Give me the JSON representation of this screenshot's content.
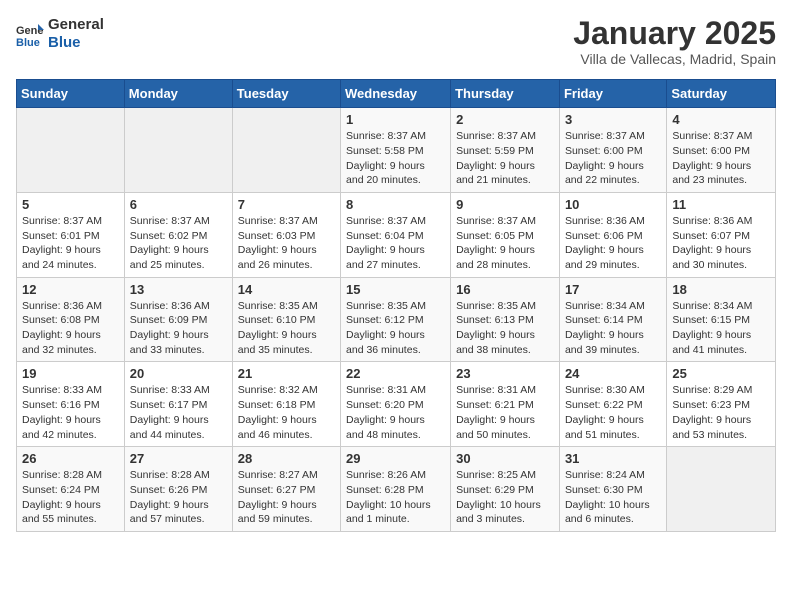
{
  "logo": {
    "line1": "General",
    "line2": "Blue"
  },
  "title": "January 2025",
  "location": "Villa de Vallecas, Madrid, Spain",
  "weekdays": [
    "Sunday",
    "Monday",
    "Tuesday",
    "Wednesday",
    "Thursday",
    "Friday",
    "Saturday"
  ],
  "weeks": [
    [
      {
        "day": "",
        "info": ""
      },
      {
        "day": "",
        "info": ""
      },
      {
        "day": "",
        "info": ""
      },
      {
        "day": "1",
        "info": "Sunrise: 8:37 AM\nSunset: 5:58 PM\nDaylight: 9 hours\nand 20 minutes."
      },
      {
        "day": "2",
        "info": "Sunrise: 8:37 AM\nSunset: 5:59 PM\nDaylight: 9 hours\nand 21 minutes."
      },
      {
        "day": "3",
        "info": "Sunrise: 8:37 AM\nSunset: 6:00 PM\nDaylight: 9 hours\nand 22 minutes."
      },
      {
        "day": "4",
        "info": "Sunrise: 8:37 AM\nSunset: 6:00 PM\nDaylight: 9 hours\nand 23 minutes."
      }
    ],
    [
      {
        "day": "5",
        "info": "Sunrise: 8:37 AM\nSunset: 6:01 PM\nDaylight: 9 hours\nand 24 minutes."
      },
      {
        "day": "6",
        "info": "Sunrise: 8:37 AM\nSunset: 6:02 PM\nDaylight: 9 hours\nand 25 minutes."
      },
      {
        "day": "7",
        "info": "Sunrise: 8:37 AM\nSunset: 6:03 PM\nDaylight: 9 hours\nand 26 minutes."
      },
      {
        "day": "8",
        "info": "Sunrise: 8:37 AM\nSunset: 6:04 PM\nDaylight: 9 hours\nand 27 minutes."
      },
      {
        "day": "9",
        "info": "Sunrise: 8:37 AM\nSunset: 6:05 PM\nDaylight: 9 hours\nand 28 minutes."
      },
      {
        "day": "10",
        "info": "Sunrise: 8:36 AM\nSunset: 6:06 PM\nDaylight: 9 hours\nand 29 minutes."
      },
      {
        "day": "11",
        "info": "Sunrise: 8:36 AM\nSunset: 6:07 PM\nDaylight: 9 hours\nand 30 minutes."
      }
    ],
    [
      {
        "day": "12",
        "info": "Sunrise: 8:36 AM\nSunset: 6:08 PM\nDaylight: 9 hours\nand 32 minutes."
      },
      {
        "day": "13",
        "info": "Sunrise: 8:36 AM\nSunset: 6:09 PM\nDaylight: 9 hours\nand 33 minutes."
      },
      {
        "day": "14",
        "info": "Sunrise: 8:35 AM\nSunset: 6:10 PM\nDaylight: 9 hours\nand 35 minutes."
      },
      {
        "day": "15",
        "info": "Sunrise: 8:35 AM\nSunset: 6:12 PM\nDaylight: 9 hours\nand 36 minutes."
      },
      {
        "day": "16",
        "info": "Sunrise: 8:35 AM\nSunset: 6:13 PM\nDaylight: 9 hours\nand 38 minutes."
      },
      {
        "day": "17",
        "info": "Sunrise: 8:34 AM\nSunset: 6:14 PM\nDaylight: 9 hours\nand 39 minutes."
      },
      {
        "day": "18",
        "info": "Sunrise: 8:34 AM\nSunset: 6:15 PM\nDaylight: 9 hours\nand 41 minutes."
      }
    ],
    [
      {
        "day": "19",
        "info": "Sunrise: 8:33 AM\nSunset: 6:16 PM\nDaylight: 9 hours\nand 42 minutes."
      },
      {
        "day": "20",
        "info": "Sunrise: 8:33 AM\nSunset: 6:17 PM\nDaylight: 9 hours\nand 44 minutes."
      },
      {
        "day": "21",
        "info": "Sunrise: 8:32 AM\nSunset: 6:18 PM\nDaylight: 9 hours\nand 46 minutes."
      },
      {
        "day": "22",
        "info": "Sunrise: 8:31 AM\nSunset: 6:20 PM\nDaylight: 9 hours\nand 48 minutes."
      },
      {
        "day": "23",
        "info": "Sunrise: 8:31 AM\nSunset: 6:21 PM\nDaylight: 9 hours\nand 50 minutes."
      },
      {
        "day": "24",
        "info": "Sunrise: 8:30 AM\nSunset: 6:22 PM\nDaylight: 9 hours\nand 51 minutes."
      },
      {
        "day": "25",
        "info": "Sunrise: 8:29 AM\nSunset: 6:23 PM\nDaylight: 9 hours\nand 53 minutes."
      }
    ],
    [
      {
        "day": "26",
        "info": "Sunrise: 8:28 AM\nSunset: 6:24 PM\nDaylight: 9 hours\nand 55 minutes."
      },
      {
        "day": "27",
        "info": "Sunrise: 8:28 AM\nSunset: 6:26 PM\nDaylight: 9 hours\nand 57 minutes."
      },
      {
        "day": "28",
        "info": "Sunrise: 8:27 AM\nSunset: 6:27 PM\nDaylight: 9 hours\nand 59 minutes."
      },
      {
        "day": "29",
        "info": "Sunrise: 8:26 AM\nSunset: 6:28 PM\nDaylight: 10 hours\nand 1 minute."
      },
      {
        "day": "30",
        "info": "Sunrise: 8:25 AM\nSunset: 6:29 PM\nDaylight: 10 hours\nand 3 minutes."
      },
      {
        "day": "31",
        "info": "Sunrise: 8:24 AM\nSunset: 6:30 PM\nDaylight: 10 hours\nand 6 minutes."
      },
      {
        "day": "",
        "info": ""
      }
    ]
  ]
}
